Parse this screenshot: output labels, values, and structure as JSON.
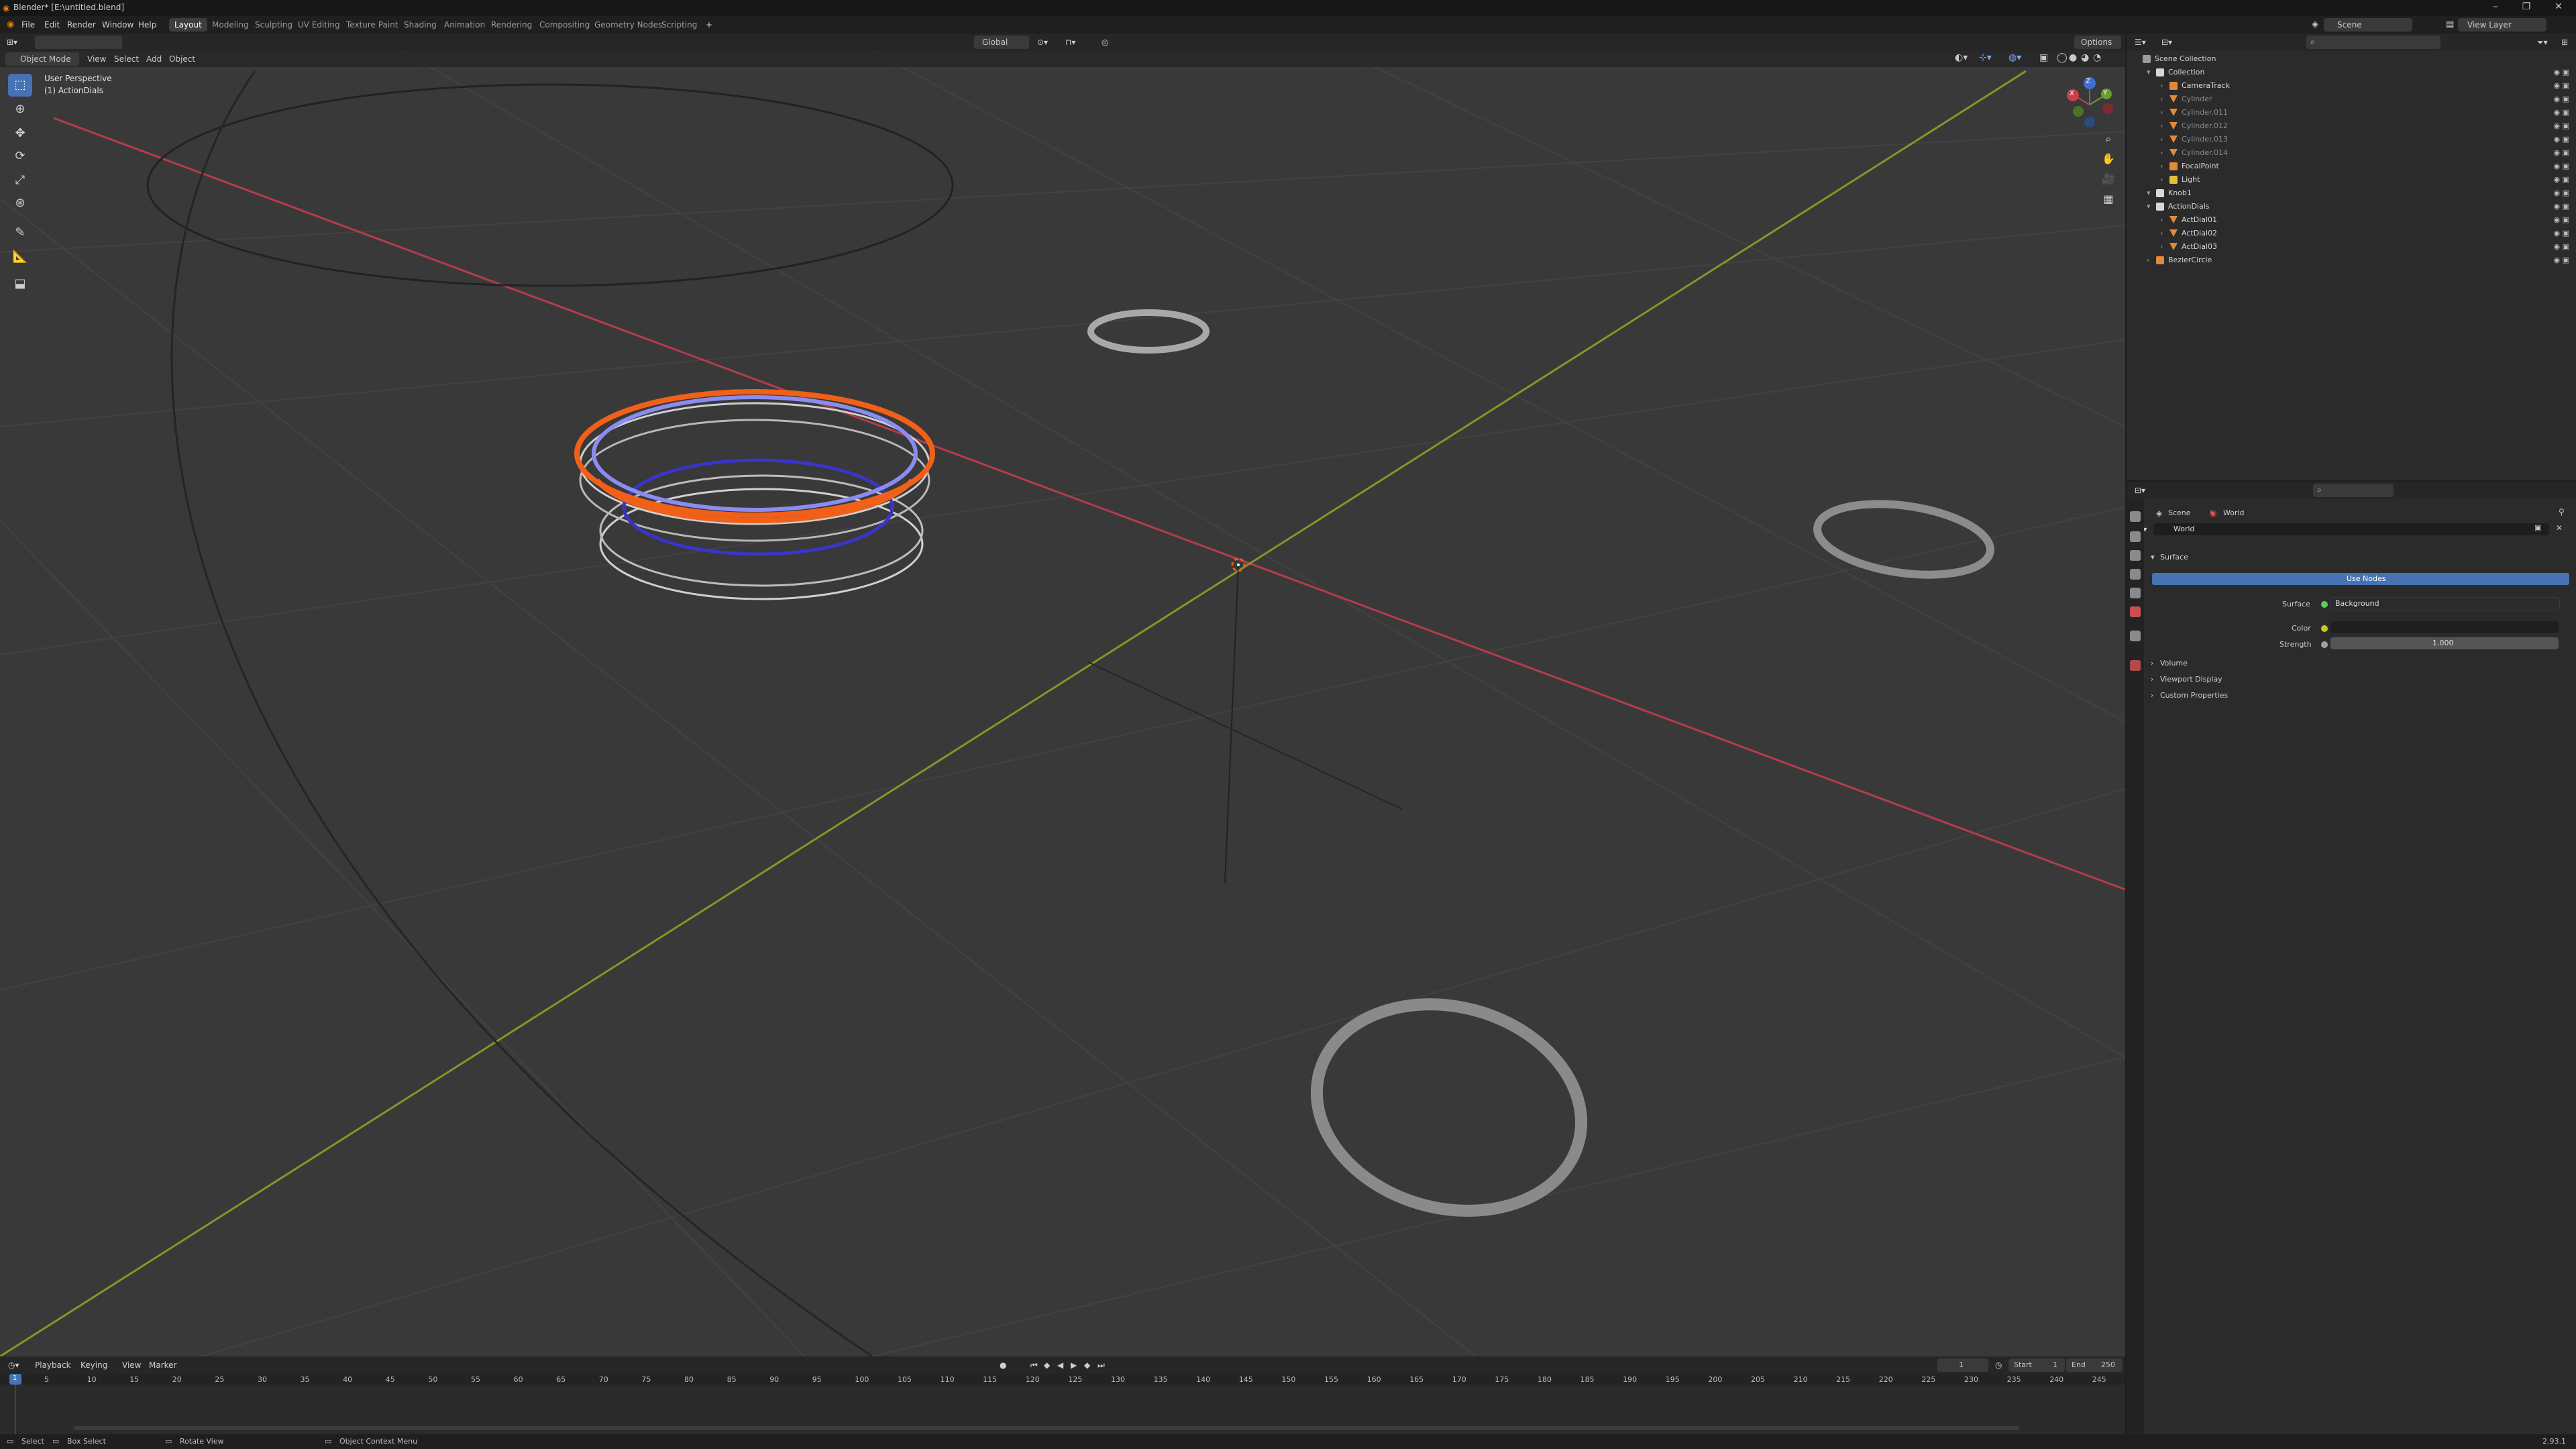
{
  "app": {
    "title": "Blender* [E:\\untitled.blend]",
    "version": "2.93.1"
  },
  "menu": [
    "File",
    "Edit",
    "Render",
    "Window",
    "Help"
  ],
  "workspaces": [
    "Layout",
    "Modeling",
    "Sculpting",
    "UV Editing",
    "Texture Paint",
    "Shading",
    "Animation",
    "Rendering",
    "Compositing",
    "Geometry Nodes",
    "Scripting"
  ],
  "active_workspace": "Layout",
  "scene_label": "Scene",
  "view_layer_label": "View Layer",
  "viewport": {
    "mode": "Object Mode",
    "menus": [
      "View",
      "Select",
      "Add",
      "Object"
    ],
    "transform_orientation": "Global",
    "options_label": "Options",
    "overlay_title": "User Perspective",
    "overlay_subtitle": "(1) ActionDials",
    "gizmo_axes": {
      "x": "X",
      "y": "Y",
      "z": "Z"
    }
  },
  "outliner": {
    "search_placeholder": "",
    "root": "Scene Collection",
    "rows": [
      {
        "label": "Collection",
        "depth": 1,
        "kind": "collection",
        "dim": false
      },
      {
        "label": "CameraTrack",
        "depth": 2,
        "kind": "curve",
        "dim": false
      },
      {
        "label": "Cylinder",
        "depth": 2,
        "kind": "mesh",
        "dim": true
      },
      {
        "label": "Cylinder.011",
        "depth": 2,
        "kind": "mesh",
        "dim": true
      },
      {
        "label": "Cylinder.012",
        "depth": 2,
        "kind": "mesh",
        "dim": true
      },
      {
        "label": "Cylinder.013",
        "depth": 2,
        "kind": "mesh",
        "dim": true
      },
      {
        "label": "Cylinder.014",
        "depth": 2,
        "kind": "mesh",
        "dim": true
      },
      {
        "label": "FocalPoint",
        "depth": 2,
        "kind": "empty",
        "dim": false
      },
      {
        "label": "Light",
        "depth": 2,
        "kind": "light",
        "dim": false
      },
      {
        "label": "Knob1",
        "depth": 1,
        "kind": "collection",
        "dim": false
      },
      {
        "label": "ActionDials",
        "depth": 1,
        "kind": "collection",
        "dim": false
      },
      {
        "label": "ActDial01",
        "depth": 2,
        "kind": "mesh",
        "dim": false
      },
      {
        "label": "ActDial02",
        "depth": 2,
        "kind": "mesh",
        "dim": false
      },
      {
        "label": "ActDial03",
        "depth": 2,
        "kind": "mesh",
        "dim": false
      },
      {
        "label": "BezierCircle",
        "depth": 1,
        "kind": "curve",
        "dim": false
      }
    ]
  },
  "properties": {
    "breadcrumb": [
      "Scene",
      "World"
    ],
    "world_name": "World",
    "surface_panel": "Surface",
    "use_nodes_label": "Use Nodes",
    "surface_label": "Surface",
    "surface_value": "Background",
    "color_label": "Color",
    "strength_label": "Strength",
    "strength_value": "1.000",
    "panels": [
      "Volume",
      "Viewport Display",
      "Custom Properties"
    ]
  },
  "timeline": {
    "menus": [
      "Playback",
      "Keying",
      "View",
      "Marker"
    ],
    "current_frame": "1",
    "start_label": "Start",
    "start_value": "1",
    "end_label": "End",
    "end_value": "250",
    "ticks": [
      "5",
      "10",
      "15",
      "20",
      "25",
      "30",
      "35",
      "40",
      "45",
      "50",
      "55",
      "60",
      "65",
      "70",
      "75",
      "80",
      "85",
      "90",
      "95",
      "100",
      "105",
      "110",
      "115",
      "120",
      "125",
      "130",
      "135",
      "140",
      "145",
      "150",
      "155",
      "160",
      "165",
      "170",
      "175",
      "180",
      "185",
      "190",
      "195",
      "200",
      "205",
      "210",
      "215",
      "220",
      "225",
      "230",
      "235",
      "240",
      "245"
    ],
    "current_marker": "1"
  },
  "status": {
    "select": "Select",
    "box_select": "Box Select",
    "rotate_view": "Rotate View",
    "context_menu": "Object Context Menu"
  },
  "colors": {
    "accent": "#4772b3",
    "selected_orange": "#f06018",
    "x_axis": "#b43c4c",
    "y_axis": "#7b9a28",
    "viewport_bg": "#3a3a3a"
  }
}
